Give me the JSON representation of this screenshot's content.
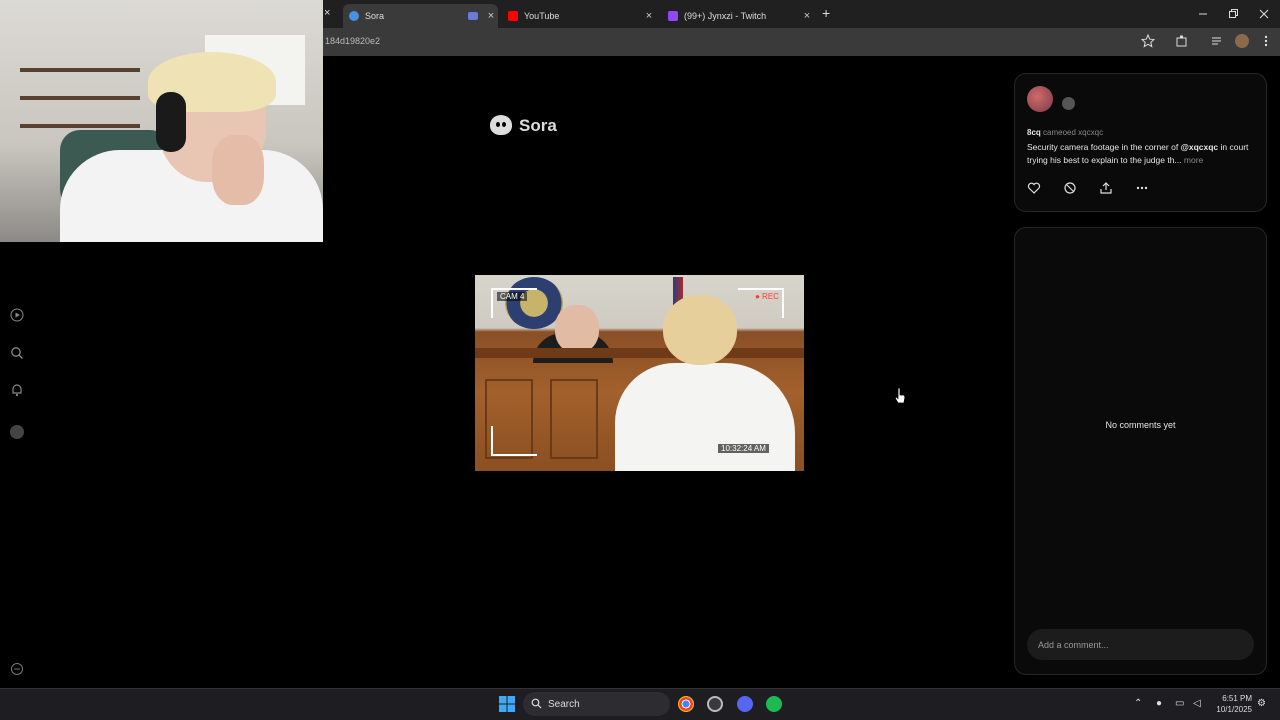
{
  "browser": {
    "tabs": [
      {
        "label": "Sora",
        "active": true,
        "favicon_color": "#4a90e2"
      },
      {
        "label": "YouTube",
        "active": false,
        "favicon_color": "#ff0000"
      },
      {
        "label": "(99+) Jynxzi - Twitch",
        "active": false,
        "favicon_color": "#9146ff"
      }
    ],
    "new_tab_label": "+",
    "close_glyph": "×",
    "url": "184d19820e2"
  },
  "app": {
    "logo_text": "Sora",
    "left_rail_icons": [
      "play-icon",
      "search-icon",
      "bell-icon",
      "profile-icon",
      "settings-icon"
    ]
  },
  "video": {
    "cam_label": "CAM 4",
    "rec_label": "● REC",
    "timestamp": "10:32:24 AM"
  },
  "post": {
    "author": "8cq",
    "cameo_text": "cameoed xqcxqc",
    "description_before": "Security camera footage in the corner of ",
    "mention": "@xqcxqc",
    "description_after": " in court trying his best to explain to the judge th...",
    "more_label": "more",
    "actions": [
      "like-icon",
      "remix-icon",
      "share-icon",
      "more-icon"
    ]
  },
  "comments": {
    "empty_text": "No comments yet",
    "input_placeholder": "Add a comment..."
  },
  "taskbar": {
    "search_label": "Search",
    "time": "6:51 PM",
    "date": "10/1/2025",
    "apps": [
      "chrome-icon",
      "obs-icon",
      "discord-icon",
      "spotify-icon"
    ]
  },
  "colors": {
    "background": "#000000",
    "panel": "#0a0a0a",
    "accent_text": "#e6e6e6",
    "muted_text": "#888888"
  }
}
